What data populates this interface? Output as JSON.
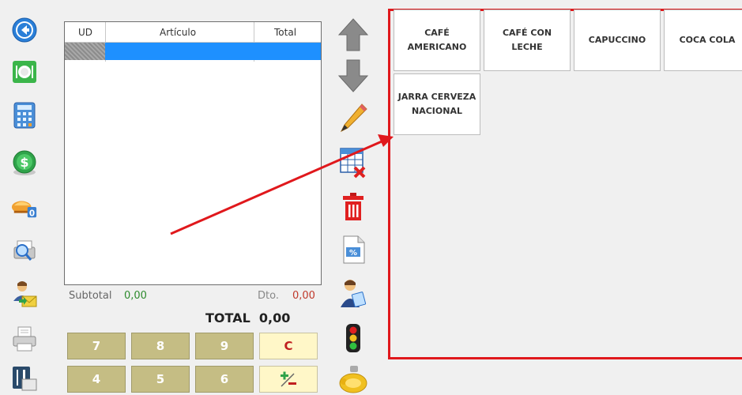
{
  "ticket": {
    "columns": [
      "UD",
      "Artículo",
      "Total"
    ],
    "subtotal_label": "Subtotal",
    "subtotal_value": "0,00",
    "discount_label": "Dto.",
    "discount_value": "0,00",
    "total_label": "TOTAL",
    "total_value": "0,00"
  },
  "keypad": {
    "keys": [
      "7",
      "8",
      "9",
      "C",
      "4",
      "5",
      "6",
      "+/-"
    ]
  },
  "products": [
    "CAFÉ AMERICANO",
    "CAFÉ CON LECHE",
    "CAPUCCINO",
    "COCA COLA",
    "JARRA CERVEZA NACIONAL"
  ],
  "colors": {
    "highlight": "#e0181c",
    "selected_row": "#1e90ff",
    "key_bg": "#c5bd84",
    "subtotal": "#2e8b2e",
    "discount": "#c0392b"
  },
  "icons": {
    "left": [
      "back-arrow-icon",
      "tables-icon",
      "calculator-icon",
      "cash-icon",
      "delivery-icon",
      "search-print-icon",
      "customer-mail-icon",
      "printer-icon",
      "restaurant-icon"
    ],
    "middle": [
      "arrow-up-icon",
      "arrow-down-icon",
      "pencil-icon",
      "delete-line-icon",
      "trash-icon",
      "discount-icon",
      "waiter-icon",
      "traffic-light-icon",
      "piggy-bank-icon"
    ]
  }
}
